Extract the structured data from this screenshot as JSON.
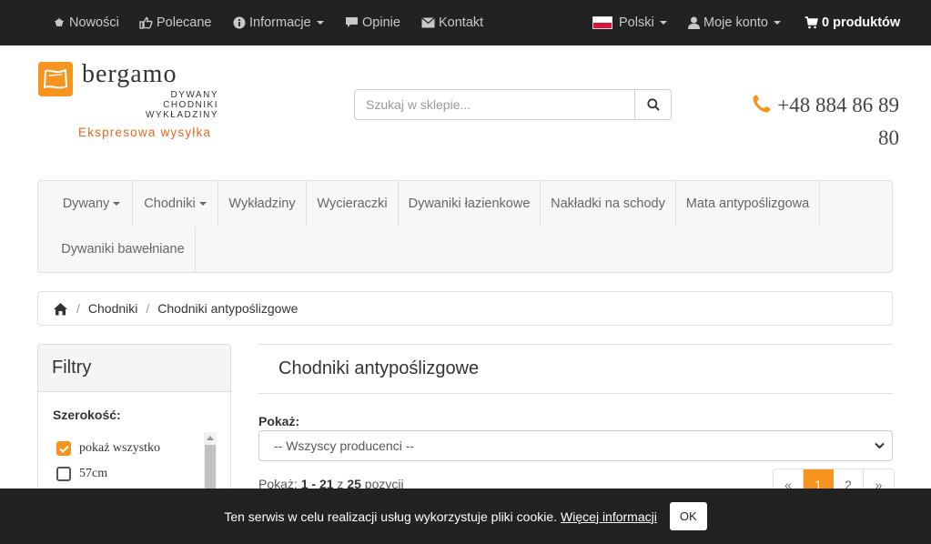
{
  "topbar": {
    "items": [
      {
        "label": "Nowości",
        "icon": "star-icon"
      },
      {
        "label": "Polecane",
        "icon": "thumbs-up-icon"
      },
      {
        "label": "Informacje",
        "icon": "info-icon"
      },
      {
        "label": "Opinie",
        "icon": "comment-icon"
      },
      {
        "label": "Kontakt",
        "icon": "envelope-icon"
      }
    ],
    "language": "Polski",
    "account": "Moje konto",
    "cart": "0 produktów"
  },
  "logo": {
    "brand": "bergamo",
    "sub": [
      "DYWANY",
      "CHODNIKI",
      "WYKŁADZINY"
    ],
    "tagline": "Ekspresowa wysyłka"
  },
  "search": {
    "placeholder": "Szukaj w sklepie..."
  },
  "phone": "+48 884 86 89 80",
  "nav": {
    "items": [
      "Dywany",
      "Chodniki",
      "Wykładziny",
      "Wycieraczki",
      "Dywaniki łazienkowe",
      "Nakładki na schody",
      "Mata antypoślizgowa",
      "Dywaniki bawełniane"
    ]
  },
  "breadcrumb": {
    "items": [
      "Chodniki",
      "Chodniki antypoślizgowe"
    ]
  },
  "filters": {
    "title": "Filtry",
    "group_label": "Szerokość:",
    "options": [
      {
        "label": "pokaż wszystko",
        "checked": true
      },
      {
        "label": "57cm",
        "checked": false
      }
    ]
  },
  "content": {
    "title": "Chodniki antypoślizgowe",
    "show_label": "Pokaż:",
    "producer_select": "-- Wszyscy producenci --",
    "count": {
      "prefix": "Pokaż:",
      "from": "1",
      "dash": "-",
      "to": "21",
      "of": "z",
      "total": "25",
      "suffix": "pozycji"
    },
    "pager": [
      "«",
      "1",
      "2",
      "»"
    ],
    "active_page": "1"
  },
  "cookie": {
    "text": "Ten serwis w celu realizacji usług wykorzystuje pliki cookie.",
    "link": "Więcej informacji",
    "ok": "OK"
  },
  "colors": {
    "accent": "#f7941d",
    "topbar": "#222222",
    "tagline": "#e8661e"
  }
}
